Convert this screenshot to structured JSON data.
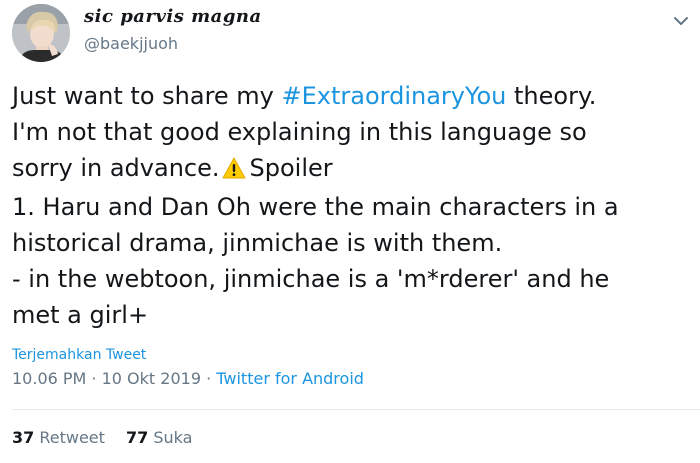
{
  "user": {
    "display_name": "sic parvis magna",
    "handle": "@baekjjuoh",
    "avatar_icon": "profile-photo"
  },
  "menu_icon": "chevron-down-icon",
  "tweet": {
    "line1_before": "Just want to share my ",
    "hashtag": "#ExtraordinaryYou",
    "line1_after": " theory.",
    "line2": "I'm not that good explaining in this language so",
    "line3_before": "sorry in advance.",
    "warning_icon": "warning-sign-icon",
    "line3_after": "Spoiler",
    "line4": "1. Haru and Dan Oh were the main characters in a",
    "line5": "historical drama, jinmichae is with them.",
    "line6": "- in the webtoon, jinmichae is a 'm*rderer' and he",
    "line7": "met a girl+"
  },
  "translate_label": "Terjemahkan Tweet",
  "meta": {
    "time": "10.06 PM",
    "sep1": " · ",
    "date": "10 Okt 2019",
    "sep2": " · ",
    "source": "Twitter for Android"
  },
  "stats": {
    "retweet_count": "37",
    "retweet_label": "Retweet",
    "like_count": "77",
    "like_label": "Suka"
  },
  "colors": {
    "link": "#1b95e0",
    "secondary_text": "#657786",
    "primary_text": "#14171a",
    "divider": "#e6ecf0",
    "warning": "#ffcc00"
  }
}
